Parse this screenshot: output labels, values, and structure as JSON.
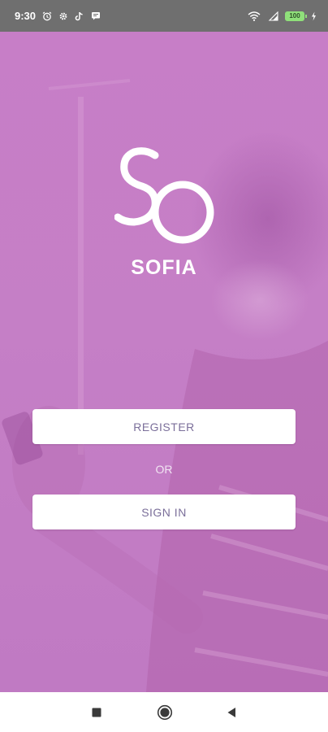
{
  "status_bar": {
    "time": "9:30",
    "left_icons": [
      "alarm-icon",
      "gear-icon",
      "tiktok-icon",
      "message-icon"
    ],
    "right_icons": [
      "wifi-icon",
      "signal-icon",
      "battery-icon",
      "charging-icon"
    ],
    "battery_level": "100"
  },
  "brand": {
    "name": "SOFIA",
    "logo_icon": "sofia-logo-icon"
  },
  "actions": {
    "register_label": "REGISTER",
    "separator_label": "OR",
    "signin_label": "SIGN IN"
  },
  "nav": {
    "icons": [
      "recent-apps-icon",
      "home-icon",
      "back-icon"
    ]
  },
  "colors": {
    "overlay": "#c77ec7",
    "button_bg": "#ffffff",
    "button_text": "#7b6f9a",
    "status_bar": "#6f6f6f"
  }
}
